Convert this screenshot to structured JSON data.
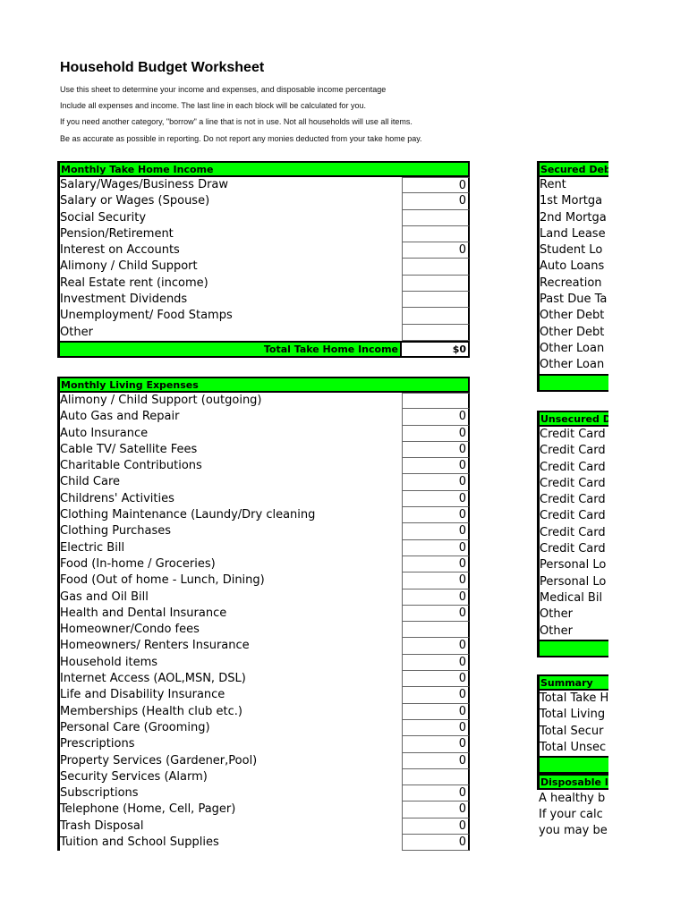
{
  "title": "Household Budget Worksheet",
  "intro": [
    "Use this sheet to determine your income and expenses, and disposable income percentage",
    "Include all expenses and income. The last line in each block will be calculated for you.",
    "If you need another category, \"borrow\" a line that is not in use. Not all households will use all items.",
    "Be as accurate as possible in reporting. Do not report any monies deducted from your take home pay."
  ],
  "income": {
    "header": "Monthly Take Home Income",
    "rows": [
      {
        "label": "Salary/Wages/Business Draw",
        "value": "0"
      },
      {
        "label": "Salary or Wages (Spouse)",
        "value": "0"
      },
      {
        "label": "Social Security",
        "value": ""
      },
      {
        "label": "Pension/Retirement",
        "value": ""
      },
      {
        "label": "Interest on Accounts",
        "value": "0"
      },
      {
        "label": "Alimony / Child Support",
        "value": ""
      },
      {
        "label": "Real Estate rent (income)",
        "value": ""
      },
      {
        "label": "Investment Dividends",
        "value": ""
      },
      {
        "label": "Unemployment/ Food Stamps",
        "value": ""
      },
      {
        "label": "Other",
        "value": ""
      }
    ],
    "total_label": "Total Take Home Income",
    "total_value": "$0"
  },
  "expenses": {
    "header": "Monthly Living Expenses",
    "rows": [
      {
        "label": "Alimony / Child Support (outgoing)",
        "value": ""
      },
      {
        "label": "Auto Gas and Repair",
        "value": "0"
      },
      {
        "label": "Auto Insurance",
        "value": "0"
      },
      {
        "label": "Cable TV/ Satellite Fees",
        "value": "0"
      },
      {
        "label": "Charitable Contributions",
        "value": "0"
      },
      {
        "label": "Child Care",
        "value": "0"
      },
      {
        "label": "Childrens' Activities",
        "value": "0"
      },
      {
        "label": "Clothing Maintenance (Laundy/Dry cleaning",
        "value": "0"
      },
      {
        "label": "Clothing Purchases",
        "value": "0"
      },
      {
        "label": "Electric Bill",
        "value": "0"
      },
      {
        "label": "Food (In-home / Groceries)",
        "value": "0"
      },
      {
        "label": "Food (Out of home - Lunch, Dining)",
        "value": "0"
      },
      {
        "label": "Gas and Oil Bill",
        "value": "0"
      },
      {
        "label": "Health and Dental Insurance",
        "value": "0"
      },
      {
        "label": "Homeowner/Condo fees",
        "value": ""
      },
      {
        "label": "Homeowners/ Renters Insurance",
        "value": "0"
      },
      {
        "label": "Household items",
        "value": "0"
      },
      {
        "label": "Internet Access (AOL,MSN, DSL)",
        "value": "0"
      },
      {
        "label": "Life and Disability Insurance",
        "value": "0"
      },
      {
        "label": "Memberships (Health club etc.)",
        "value": "0"
      },
      {
        "label": "Personal Care (Grooming)",
        "value": "0"
      },
      {
        "label": "Prescriptions",
        "value": "0"
      },
      {
        "label": "Property Services (Gardener,Pool)",
        "value": "0"
      },
      {
        "label": "Security Services (Alarm)",
        "value": ""
      },
      {
        "label": "Subscriptions",
        "value": "0"
      },
      {
        "label": "Telephone (Home, Cell, Pager)",
        "value": "0"
      },
      {
        "label": "Trash Disposal",
        "value": "0"
      },
      {
        "label": "Tuition and School Supplies",
        "value": "0"
      }
    ]
  },
  "secured": {
    "header": "Secured Deb",
    "rows": [
      "Rent",
      "1st Mortga",
      "2nd Mortga",
      "Land Lease",
      "Student Lo",
      "Auto Loans",
      "Recreation",
      "Past Due Ta",
      "Other Debt",
      "Other Debt",
      "Other Loan",
      "Other Loan"
    ]
  },
  "unsecured": {
    "header": "Unsecured D",
    "rows": [
      "Credit Card",
      "Credit Card",
      "Credit Card",
      "Credit Card",
      "Credit Card",
      "Credit Card",
      "Credit Card",
      "Credit Card",
      "Personal Lo",
      "Personal Lo",
      "Medical Bil",
      "Other",
      "Other"
    ]
  },
  "summary": {
    "header": "Summary",
    "rows": [
      "Total Take H",
      "Total Living",
      "Total Secur",
      "Total Unsec"
    ]
  },
  "disposable": {
    "header": "Disposable I",
    "notes": [
      "A healthy b",
      "If your calc",
      "you may be"
    ]
  },
  "colors": {
    "accent_green": "#00ff00"
  }
}
